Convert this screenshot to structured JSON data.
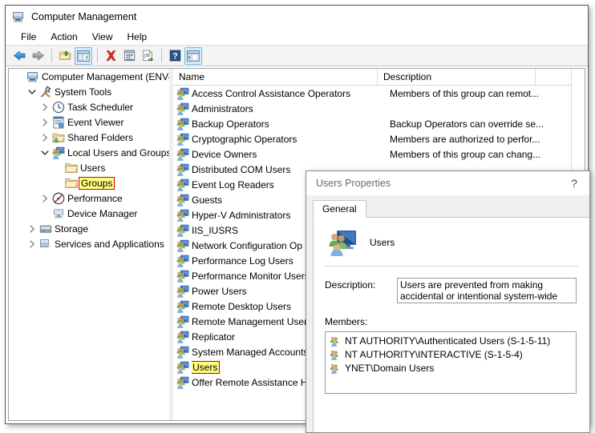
{
  "window": {
    "title": "Computer Management",
    "icon": "computer-management-icon"
  },
  "menu": {
    "items": [
      {
        "label": "File"
      },
      {
        "label": "Action"
      },
      {
        "label": "View"
      },
      {
        "label": "Help"
      }
    ]
  },
  "toolbar": {
    "buttons": [
      {
        "name": "back-button",
        "icon": "back-arrow-icon",
        "pressed": false
      },
      {
        "name": "forward-button",
        "icon": "forward-arrow-icon",
        "pressed": false
      },
      {
        "name": "up-one-level-button",
        "icon": "folder-up-icon",
        "pressed": false
      },
      {
        "name": "show-hide-tree-button",
        "icon": "tree-pane-icon",
        "pressed": true
      },
      {
        "name": "delete-button",
        "icon": "delete-x-icon",
        "pressed": false
      },
      {
        "name": "properties-button",
        "icon": "properties-icon",
        "pressed": false
      },
      {
        "name": "export-list-button",
        "icon": "export-list-icon",
        "pressed": false
      },
      {
        "name": "help-button",
        "icon": "help-question-icon",
        "pressed": false
      },
      {
        "name": "show-action-pane-button",
        "icon": "action-pane-icon",
        "pressed": true
      }
    ]
  },
  "tree": {
    "items": [
      {
        "label": "Computer Management (ENV-Y",
        "icon": "computer-icon",
        "indent": 0,
        "twisty": "none",
        "highlight": false
      },
      {
        "label": "System Tools",
        "icon": "system-tools-icon",
        "indent": 1,
        "twisty": "expanded",
        "highlight": false
      },
      {
        "label": "Task Scheduler",
        "icon": "clock-icon",
        "indent": 2,
        "twisty": "collapsed",
        "highlight": false
      },
      {
        "label": "Event Viewer",
        "icon": "event-viewer-icon",
        "indent": 2,
        "twisty": "collapsed",
        "highlight": false
      },
      {
        "label": "Shared Folders",
        "icon": "shared-folders-icon",
        "indent": 2,
        "twisty": "collapsed",
        "highlight": false
      },
      {
        "label": "Local Users and Groups",
        "icon": "local-users-groups-icon",
        "indent": 2,
        "twisty": "expanded",
        "highlight": false
      },
      {
        "label": "Users",
        "icon": "folder-icon",
        "indent": 3,
        "twisty": "none",
        "highlight": false
      },
      {
        "label": "Groups",
        "icon": "folder-icon",
        "indent": 3,
        "twisty": "none",
        "highlight": true
      },
      {
        "label": "Performance",
        "icon": "performance-icon",
        "indent": 2,
        "twisty": "collapsed",
        "highlight": false
      },
      {
        "label": "Device Manager",
        "icon": "device-manager-icon",
        "indent": 2,
        "twisty": "none",
        "highlight": false
      },
      {
        "label": "Storage",
        "icon": "storage-icon",
        "indent": 1,
        "twisty": "collapsed",
        "highlight": false
      },
      {
        "label": "Services and Applications",
        "icon": "services-icon",
        "indent": 1,
        "twisty": "collapsed",
        "highlight": false
      }
    ]
  },
  "list": {
    "columns": [
      {
        "label": "Name"
      },
      {
        "label": "Description"
      },
      {
        "label": ""
      }
    ],
    "rows": [
      {
        "name": "Access Control Assistance Operators",
        "description": "Members of this group can remot...",
        "highlight": false
      },
      {
        "name": "Administrators",
        "description": "",
        "highlight": false
      },
      {
        "name": "Backup Operators",
        "description": "Backup Operators can override se...",
        "highlight": false
      },
      {
        "name": "Cryptographic Operators",
        "description": "Members are authorized to perfor...",
        "highlight": false
      },
      {
        "name": "Device Owners",
        "description": "Members of this group can chang...",
        "highlight": false
      },
      {
        "name": "Distributed COM Users",
        "description": "",
        "highlight": false
      },
      {
        "name": "Event Log Readers",
        "description": "",
        "highlight": false
      },
      {
        "name": "Guests",
        "description": "",
        "highlight": false
      },
      {
        "name": "Hyper-V Administrators",
        "description": "",
        "highlight": false
      },
      {
        "name": "IIS_IUSRS",
        "description": "",
        "highlight": false
      },
      {
        "name": "Network Configuration Op",
        "description": "",
        "highlight": false
      },
      {
        "name": "Performance Log Users",
        "description": "",
        "highlight": false
      },
      {
        "name": "Performance Monitor Users",
        "description": "",
        "highlight": false
      },
      {
        "name": "Power Users",
        "description": "",
        "highlight": false
      },
      {
        "name": "Remote Desktop Users",
        "description": "",
        "highlight": false
      },
      {
        "name": "Remote Management Users",
        "description": "",
        "highlight": false
      },
      {
        "name": "Replicator",
        "description": "",
        "highlight": false
      },
      {
        "name": "System Managed Accounts",
        "description": "",
        "highlight": false
      },
      {
        "name": "Users",
        "description": "",
        "highlight": true
      },
      {
        "name": "Offer Remote Assistance H",
        "description": "",
        "highlight": false
      }
    ]
  },
  "dialog": {
    "title": "Users Properties",
    "help_glyph": "?",
    "tabs": [
      {
        "label": "General",
        "active": true
      }
    ],
    "group_name": "Users",
    "description_label": "Description:",
    "description_value": "Users are prevented from making accidental or intentional system-wide changes and can run most",
    "members_label": "Members:",
    "members": [
      {
        "name": "NT AUTHORITY\\Authenticated Users (S-1-5-11)"
      },
      {
        "name": "NT AUTHORITY\\INTERACTIVE (S-1-5-4)"
      },
      {
        "name": "YNET\\Domain Users"
      }
    ]
  },
  "colors": {
    "highlight_bg": "#ffff7f",
    "highlight_border": "#cc0000",
    "toolbar_bg": "#f3f3f3",
    "dialog_bg": "#f0f0f0"
  }
}
